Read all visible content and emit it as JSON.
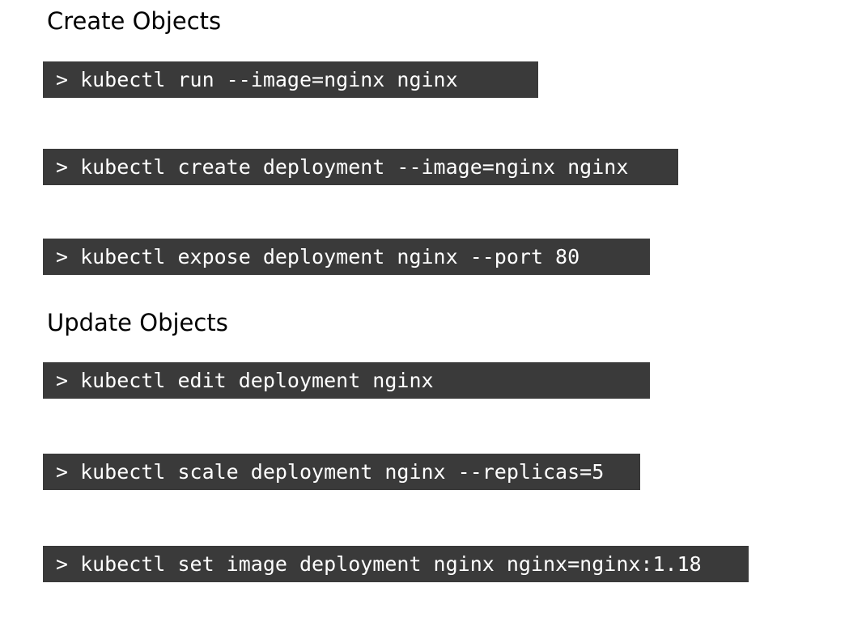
{
  "sections": [
    {
      "heading": "Create Objects",
      "commands": [
        "kubectl run --image=nginx nginx",
        "kubectl create deployment --image=nginx nginx",
        "kubectl expose deployment nginx --port 80"
      ]
    },
    {
      "heading": "Update Objects",
      "commands": [
        "kubectl edit deployment nginx",
        "kubectl scale deployment nginx --replicas=5",
        "kubectl set image deployment nginx nginx=nginx:1.18"
      ]
    }
  ],
  "prompt_symbol": ">",
  "colors": {
    "command_background": "#3a3a3a",
    "command_text": "#ffffff",
    "heading_text": "#000000",
    "page_background": "#ffffff"
  }
}
